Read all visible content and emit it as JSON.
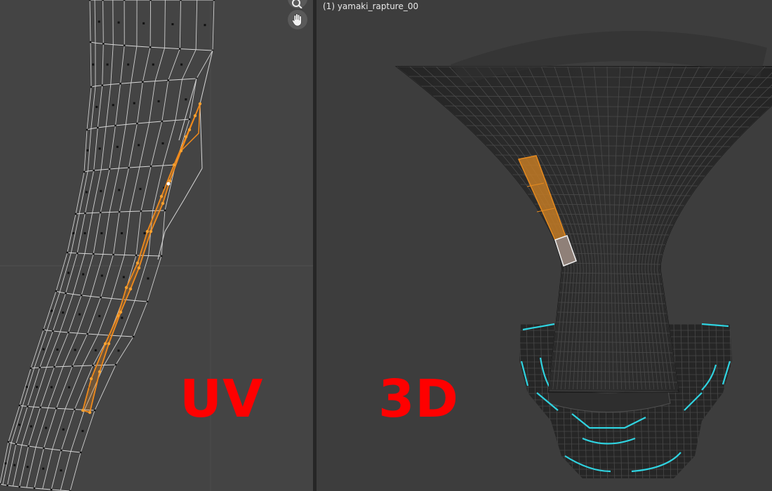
{
  "uv_editor": {
    "label": "UV",
    "label_color": "#ff0000",
    "selection_color": "#f08a1c",
    "icons": [
      "zoom-icon",
      "hand-pan-icon"
    ]
  },
  "viewport_3d": {
    "object_name": "(1) yamaki_rapture_00",
    "label": "3D",
    "label_color": "#ff0000",
    "highlight_color": "#2fd3e0",
    "selection_color": "#e58a1f"
  }
}
